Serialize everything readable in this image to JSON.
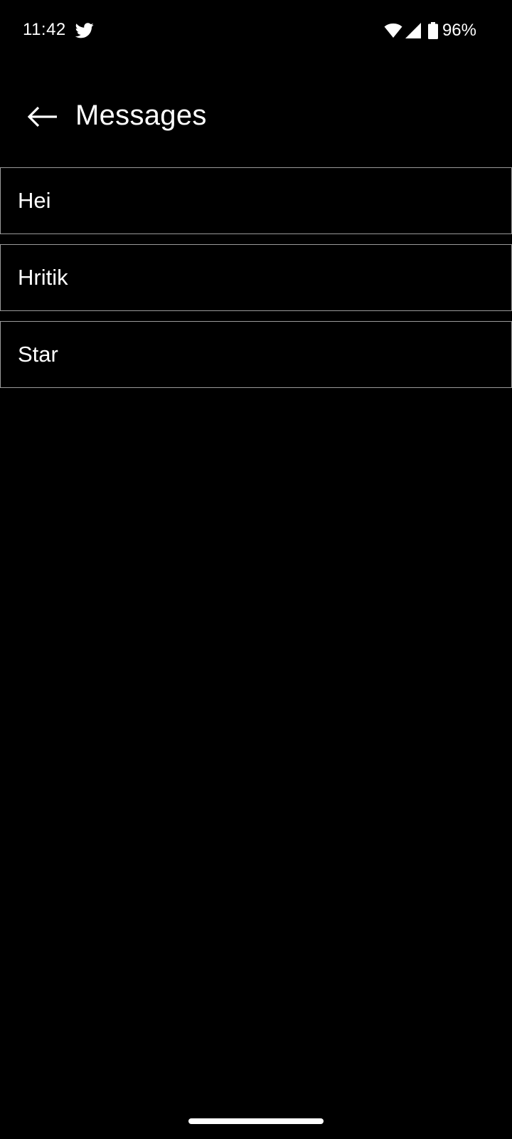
{
  "status_bar": {
    "time": "11:42",
    "notification_icon": "twitter-icon",
    "battery_percent": "96%"
  },
  "app_bar": {
    "title": "Messages",
    "back_icon": "arrow-back-icon"
  },
  "messages": [
    {
      "label": "Hei"
    },
    {
      "label": "Hritik"
    },
    {
      "label": "Star"
    }
  ],
  "colors": {
    "background": "#000000",
    "text": "#ffffff",
    "item_border": "#9a9a9a"
  }
}
